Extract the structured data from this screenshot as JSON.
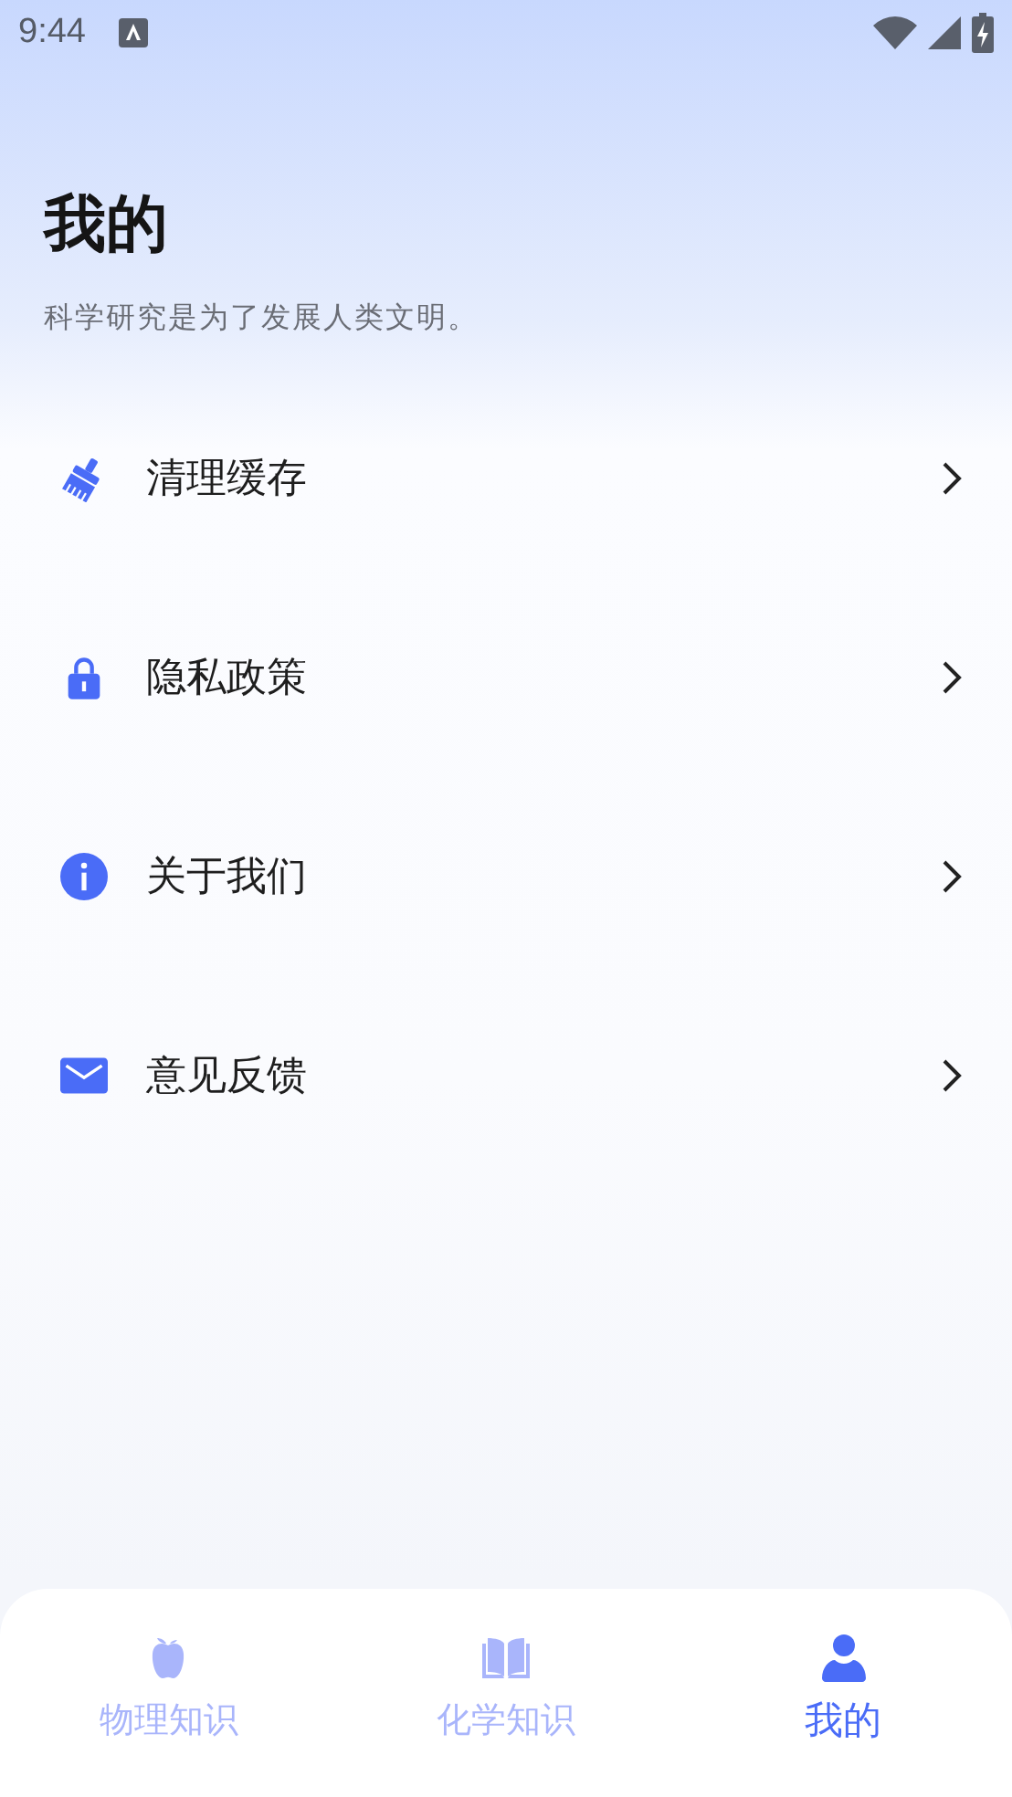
{
  "status_bar": {
    "time": "9:44"
  },
  "header": {
    "title": "我的",
    "subtitle": "科学研究是为了发展人类文明。"
  },
  "menu": [
    {
      "kind": "broom",
      "label": "清理缓存"
    },
    {
      "kind": "lock",
      "label": "隐私政策"
    },
    {
      "kind": "info",
      "label": "关于我们"
    },
    {
      "kind": "mail",
      "label": "意见反馈"
    }
  ],
  "tabs": [
    {
      "kind": "apple",
      "label": "物理知识",
      "selected": false
    },
    {
      "kind": "book",
      "label": "化学知识",
      "selected": false
    },
    {
      "kind": "person",
      "label": "我的",
      "selected": true
    }
  ]
}
